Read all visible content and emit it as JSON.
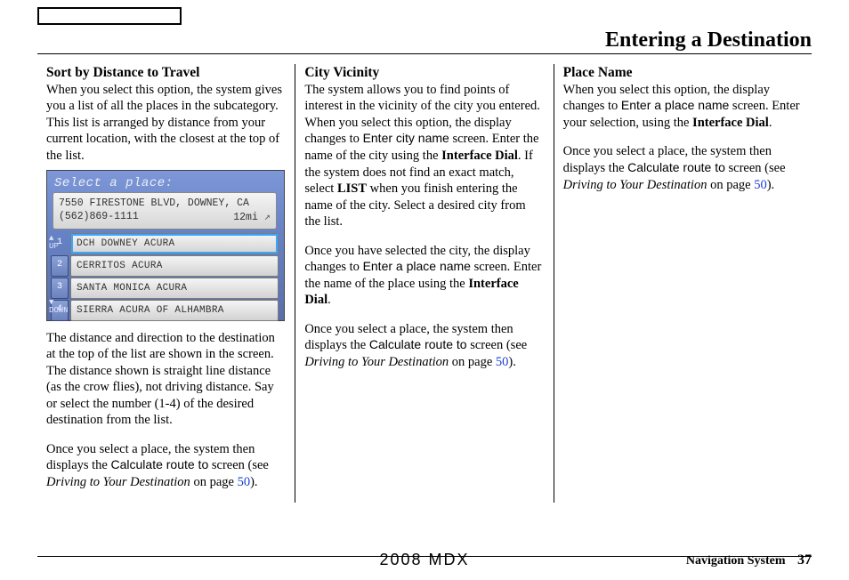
{
  "page_title": "Entering a Destination",
  "footer": {
    "center": "2008  MDX",
    "label": "Navigation System",
    "page": "37"
  },
  "col1": {
    "heading": "Sort by Distance to Travel",
    "p1": "When you select this option, the system gives you a list of all the places in the subcategory. This list is arranged by distance from your current location, with the closest at the top of the list.",
    "p2": "The distance and direction to the destination at the top of the list are shown in the screen. The distance shown is straight line distance (as the crow flies), not driving distance. Say or select the number (1-4) of the desired destination from the list.",
    "p3a": "Once you select a place, the system then displays the ",
    "p3_ui": "Calculate route to",
    "p3b": " screen (see ",
    "p3_it": "Driving to Your Destination",
    "p3c": " on page ",
    "p3_link": "50",
    "p3d": ")."
  },
  "nav": {
    "header": "Select a place:",
    "address": "7550 FIRESTONE BLVD, DOWNEY, CA",
    "phone": "(562)869-1111",
    "dist": "12mi",
    "rows": [
      "DCH DOWNEY ACURA",
      "CERRITOS ACURA",
      "SANTA MONICA ACURA",
      "SIERRA ACURA OF ALHAMBRA"
    ],
    "nums": [
      "1",
      "2",
      "3",
      "4"
    ]
  },
  "col2": {
    "heading": "City Vicinity",
    "p1a": "The system allows you to find points of interest in the vicinity of the city you entered. When you select this option, the display changes to ",
    "p1_ui1": "Enter city name",
    "p1b": " screen. Enter the name of the city using the ",
    "p1_b1": "Interface Dial",
    "p1c": ". If the system does not find an exact match, select ",
    "p1_b2": "LIST",
    "p1d": " when you finish entering the name of the city. Select a desired city from the list.",
    "p2a": "Once you have selected the city, the display changes to ",
    "p2_ui": "Enter a place name",
    "p2b": " screen. Enter the name of the place using the ",
    "p2_bold": "Interface Dial",
    "p2c": ".",
    "p3a": "Once you select a place, the system then displays the ",
    "p3_ui": "Calculate route to",
    "p3b": " screen (see ",
    "p3_it": "Driving to Your Destination",
    "p3c": " on page ",
    "p3_link": "50",
    "p3d": ")."
  },
  "col3": {
    "heading": "Place Name",
    "p1a": "When you select this option, the display changes to ",
    "p1_ui": "Enter a place name",
    "p1b": " screen. Enter your selection, using the ",
    "p1_bold": "Interface Dial",
    "p1c": ".",
    "p2a": "Once you select a place, the system then displays the ",
    "p2_ui": "Calculate route to",
    "p2b": " screen (see ",
    "p2_it": "Driving to Your Destination",
    "p2c": " on page ",
    "p2_link": "50",
    "p2d": ")."
  }
}
